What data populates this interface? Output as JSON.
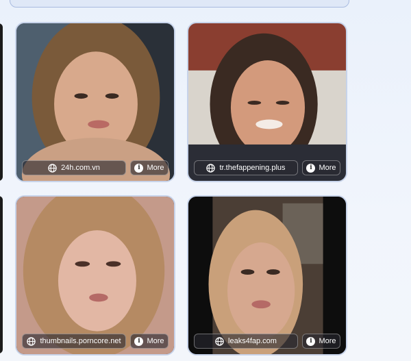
{
  "cards": [
    {
      "source": "24h.com.vn",
      "more_label": "More",
      "tone": "#b58468"
    },
    {
      "source": "tr.thefappening.plus",
      "more_label": "More",
      "tone": "#a87a63"
    },
    {
      "source": "thumbnails.porncore.net",
      "more_label": "More",
      "tone": "#c59a86"
    },
    {
      "source": "leaks4fap.com",
      "more_label": "More",
      "tone": "#9a7a66"
    }
  ],
  "icons": {
    "source": "globe-icon",
    "more": "info-icon"
  }
}
